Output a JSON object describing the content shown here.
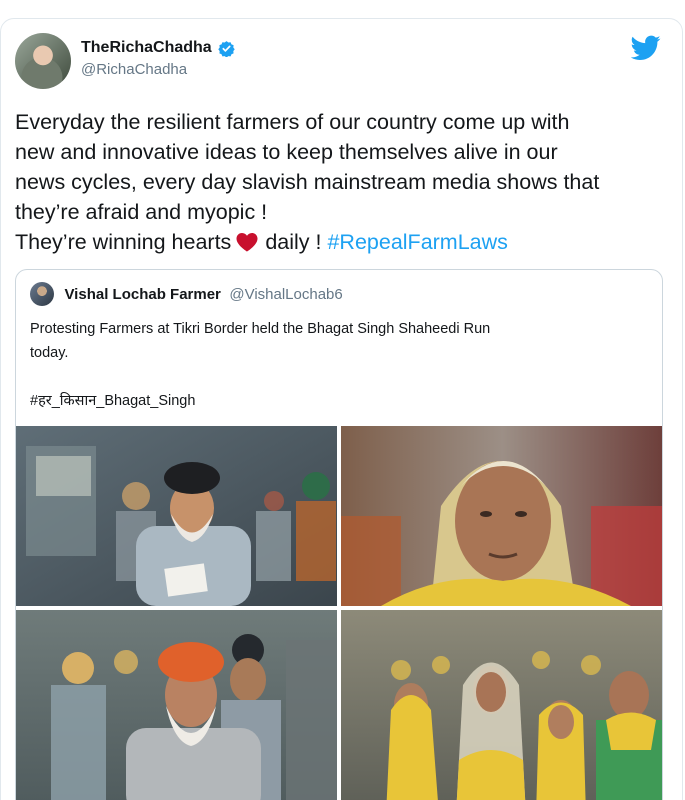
{
  "tweet": {
    "author": {
      "display_name": "TheRichaChadha",
      "handle": "@RichaChadha",
      "verified": true
    },
    "text_lines": [
      "Everyday the resilient farmers of our country come up with",
      "new and innovative ideas to keep themselves alive in our",
      "news cycles, every day slavish mainstream media shows that",
      "they’re afraid and myopic !"
    ],
    "last_line": {
      "before_heart": "They’re winning hearts",
      "after_heart": "daily !",
      "hashtag": "#RepealFarmLaws"
    },
    "icons": [
      "twitter-bird-icon",
      "verified-badge-icon",
      "red-heart-icon"
    ]
  },
  "quoted_tweet": {
    "author": {
      "display_name": "Vishal Lochab Farmer",
      "handle": "@VishalLochab6"
    },
    "text_lines": [
      "Protesting Farmers at Tikri Border held the Bhagat Singh Shaheedi Run",
      "today.",
      "",
      "#हर_किसान_Bhagat_Singh"
    ],
    "photos": [
      {
        "subject": "elderly man in black turban holding paper"
      },
      {
        "subject": "elderly woman in yellow headscarf"
      },
      {
        "subject": "elderly man in orange turban running"
      },
      {
        "subject": "group of women in yellow scarves"
      }
    ]
  },
  "colors": {
    "accent": "#1da1f2",
    "text": "#14171a",
    "secondary_text": "#657786",
    "heart": "#e0245e",
    "border": "#ccd6dd"
  }
}
